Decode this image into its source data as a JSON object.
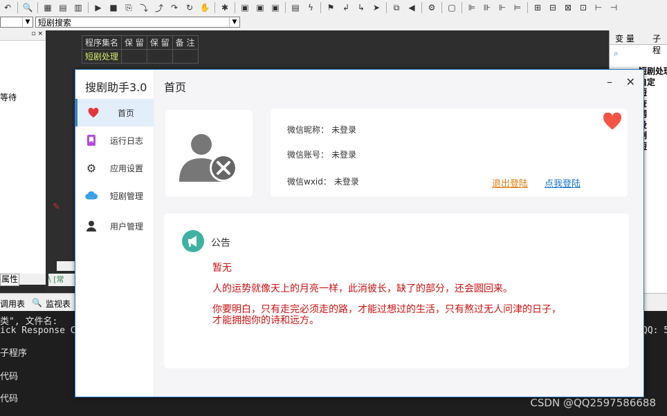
{
  "ide": {
    "combo_left_value": "",
    "combo_search_value": "短剧搜索",
    "table_headers": [
      "程序集名",
      "保 留",
      "保 留",
      "备 注"
    ],
    "table_row": [
      "短剧处理",
      "",
      "",
      ""
    ],
    "left_wait_text": "等待",
    "left_tab_label": "属性",
    "tabstrip_label": "\\ [常",
    "midbar": {
      "call_table": "调用表",
      "monitor_table": "监视表"
    },
    "console_lines": [
      "类\", 文件名:",
      "ick Response C",
      "子程序",
      "代码",
      "代码"
    ],
    "console_right": "QQ: 5",
    "right_tabs": [
      "变 量",
      "子程"
    ],
    "right_tree": [
      "短剧处理",
      "自定",
      "短",
      "查",
      "网",
      "没",
      "删",
      "短"
    ],
    "watermark": "CSDN @QQ2597586688"
  },
  "app": {
    "title": "搜剧助手3.0",
    "page_title": "首页",
    "window_controls": {
      "minimize": "–",
      "close": "✕"
    },
    "nav": [
      {
        "label": "首页",
        "icon": "heart-icon",
        "color": "#e5363b",
        "active": true
      },
      {
        "label": "运行日志",
        "icon": "bookmark-icon",
        "color": "#b44ee0",
        "active": false
      },
      {
        "label": "应用设置",
        "icon": "gear-icon",
        "color": "#333333",
        "active": false
      },
      {
        "label": "短剧管理",
        "icon": "cloud-icon",
        "color": "#3aa0e8",
        "active": false
      },
      {
        "label": "用户管理",
        "icon": "user-icon",
        "color": "#333333",
        "active": false
      }
    ],
    "profile": {
      "nickname_label": "微信昵称：",
      "nickname_value": "未登录",
      "account_label": "微信账号：",
      "account_value": "未登录",
      "wxid_label": "微信wxid：",
      "wxid_value": "未登录",
      "logout_label": "退出登陆",
      "login_label": "点我登陆"
    },
    "notice": {
      "title": "公告",
      "lines": [
        "暂无",
        "人的运势就像天上的月亮一样，此消彼长，缺了的部分，还会圆回来。",
        "你要明白，只有走完必须走的路，才能过想过的生活，只有熬过无人问津的日子，",
        "才能拥抱你的诗和远方。"
      ]
    },
    "colors": {
      "accent": "#3a7fd6",
      "notice_text": "#cc1111",
      "heart": "#f25545"
    }
  }
}
